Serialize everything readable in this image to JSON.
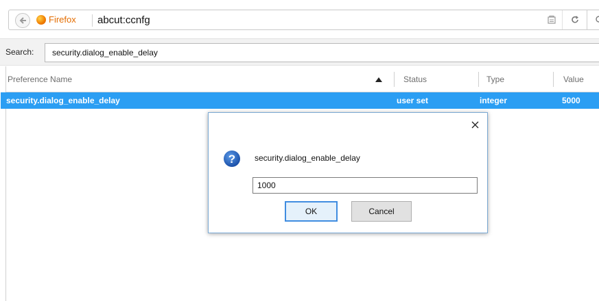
{
  "browser": {
    "identity_label": "Firefox",
    "url": "abcut:ccnfg"
  },
  "search": {
    "label": "Search:",
    "value": "security.dialog_enable_delay"
  },
  "table": {
    "columns": [
      "Preference Name",
      "Status",
      "Type",
      "Value"
    ],
    "rows": [
      {
        "name": "security.dialog_enable_delay",
        "status": "user set",
        "type": "integer",
        "value": "5000"
      }
    ]
  },
  "dialog": {
    "message": "security.dialog_enable_delay",
    "input_value": "1000",
    "ok_label": "OK",
    "cancel_label": "Cancel"
  },
  "colors": {
    "selection": "#2b9ef3",
    "firefox_brand": "#e46d00",
    "question_icon": "#1e5bb5"
  },
  "icons": {
    "back": "back-arrow-icon",
    "firefox": "firefox-icon",
    "reader": "reader-view-icon",
    "reload": "reload-icon",
    "sort": "sort-ascending-icon",
    "close": "close-icon",
    "question": "question-icon"
  }
}
